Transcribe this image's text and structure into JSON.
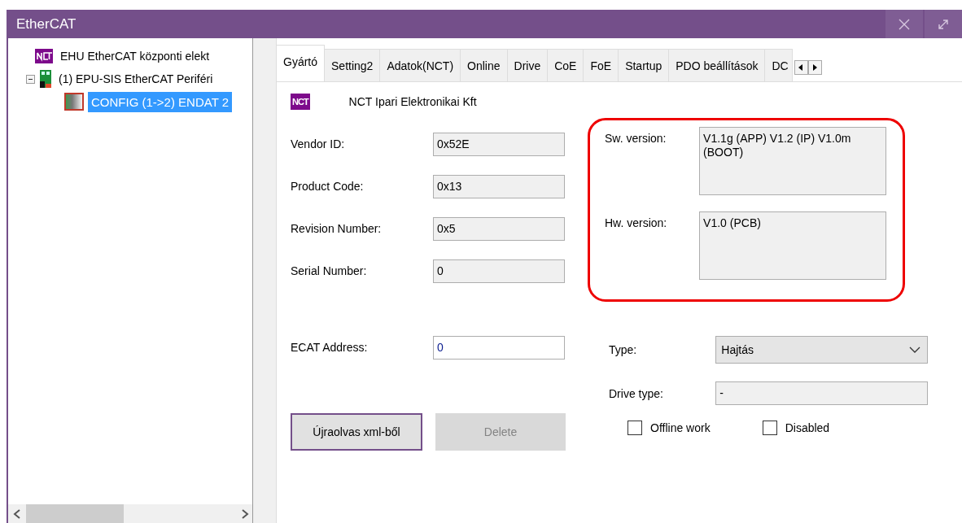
{
  "window": {
    "title": "EtherCAT"
  },
  "tree": [
    {
      "label": "EHU EtherCAT központi elekt",
      "kind": "vendor",
      "selected": false
    },
    {
      "label": "(1) EPU-SIS EtherCAT Periféri",
      "kind": "device",
      "expanded": true,
      "selected": false,
      "children": [
        {
          "label": "CONFIG (1->2) ENDAT 2",
          "kind": "module",
          "selected": true
        }
      ]
    }
  ],
  "tabs": [
    {
      "label": "Gyártó",
      "selected": true
    },
    {
      "label": "Setting2",
      "selected": false
    },
    {
      "label": "Adatok(NCT)",
      "selected": false
    },
    {
      "label": "Online",
      "selected": false
    },
    {
      "label": "Drive",
      "selected": false
    },
    {
      "label": "CoE",
      "selected": false
    },
    {
      "label": "FoE",
      "selected": false
    },
    {
      "label": "Startup",
      "selected": false
    },
    {
      "label": "PDO beállítások",
      "selected": false
    },
    {
      "label": "DC",
      "selected": false
    }
  ],
  "vendor": {
    "logo": "NCT",
    "name": "NCT Ipari Elektronikai Kft"
  },
  "identity": [
    {
      "label": "Vendor ID:",
      "value": "0x52E"
    },
    {
      "label": "Product Code:",
      "value": "0x13"
    },
    {
      "label": "Revision Number:",
      "value": "0x5"
    },
    {
      "label": "Serial Number:",
      "value": "0"
    }
  ],
  "versions": [
    {
      "label": "Sw. version:",
      "value": "V1.1g (APP)  V1.2 (IP)  V1.0m (BOOT)"
    },
    {
      "label": "Hw. version:",
      "value": "V1.0 (PCB)"
    }
  ],
  "ecat_address": {
    "label": "ECAT Address:",
    "value": "0"
  },
  "type": {
    "label": "Type:",
    "value": "Hajtás"
  },
  "drive_type": {
    "label": "Drive type:",
    "value": "-"
  },
  "buttons": [
    {
      "label": "Újraolvas xml-ből",
      "disabled": false
    },
    {
      "label": "Delete",
      "disabled": true
    }
  ],
  "checkboxes": [
    {
      "label": "Offline work",
      "checked": false
    },
    {
      "label": "Disabled",
      "checked": false
    }
  ]
}
